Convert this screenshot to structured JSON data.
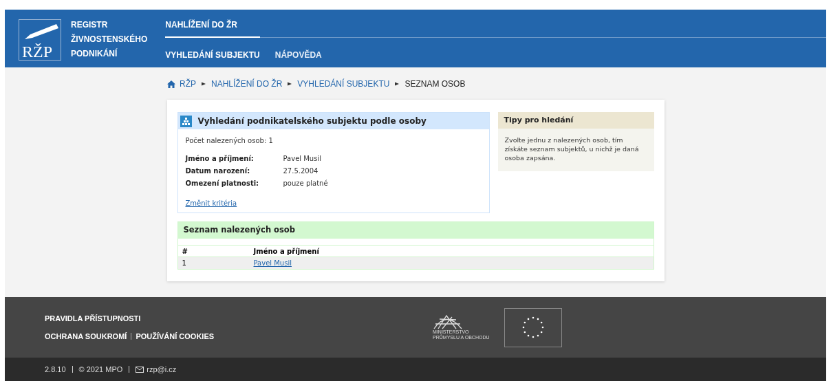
{
  "header": {
    "logo_text": "RŽP",
    "site_name": [
      "REGISTR",
      "ŽIVNOSTENSKÉHO",
      "PODNIKÁNÍ"
    ],
    "section": "NAHLÍŽENÍ DO ŽR",
    "nav": [
      {
        "label": "VYHLEDÁNÍ SUBJEKTU",
        "selected": true
      },
      {
        "label": "NÁPOVĚDA",
        "selected": false
      }
    ]
  },
  "breadcrumb": [
    "RŽP",
    "NAHLÍŽENÍ DO ŽR",
    "VYHLEDÁNÍ SUBJEKTU",
    "SEZNAM OSOB"
  ],
  "search_panel": {
    "title": "Vyhledání podnikatelského subjektu podle osoby",
    "count": "Počet nalezených osob: 1",
    "fields": [
      {
        "label": "Jméno a příjmení:",
        "value": "Pavel Musil"
      },
      {
        "label": "Datum narození:",
        "value": "27.5.2004"
      },
      {
        "label": "Omezení platnosti:",
        "value": "pouze platné"
      }
    ],
    "link": "Změnit kritéria"
  },
  "tips": {
    "title": "Tipy pro hledání",
    "text": "Zvolte jednu z nalezených osob, tím získáte seznam subjektů, u nichž je daná osoba zapsána."
  },
  "results": {
    "title": "Seznam nalezených osob",
    "columns": [
      "#",
      "Jméno a příjmení"
    ],
    "rows": [
      {
        "number": "1",
        "name": "Pavel Musil"
      }
    ]
  },
  "footer": {
    "links": [
      "PRAVIDLA PŘÍSTUPNOSTI",
      "OCHRANA SOUKROMÍ",
      "POUŽÍVÁNÍ COOKIES"
    ],
    "ministry": [
      "MINISTERSTVO",
      "PRŮMYSLU A OBCHODU"
    ],
    "version": "2.8.10",
    "copyright": "© 2021 MPO",
    "email": "rzp@i.cz"
  }
}
